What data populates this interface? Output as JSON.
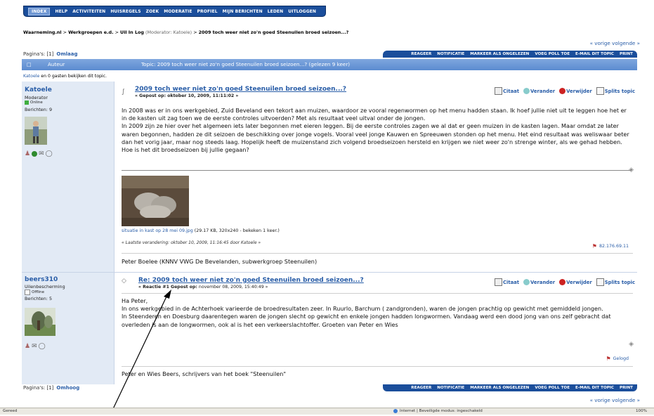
{
  "topnav": {
    "items": [
      "INDEX",
      "HELP",
      "ACTIVITEITEN",
      "HUISREGELS",
      "ZOEK",
      "MODERATIE",
      "PROFIEL",
      "MIJN BERICHTEN",
      "LEDEN",
      "UITLOGGEN"
    ]
  },
  "breadcrumb": {
    "site": "Waarneming.nl",
    "sep": ">",
    "group": "Werkgroepen e.d.",
    "board": "Uil In Log",
    "moderator": "(Moderator: Katoele)",
    "topic": "2009 toch weer niet zo'n goed Steenuilen broed seizoen...?"
  },
  "prevnext": "« vorige volgende »",
  "pagination_top": {
    "label": "Pagina's: [1]",
    "link": "Omlaag"
  },
  "pagination_bottom": {
    "label": "Pagina's: [1]",
    "link": "Omhoog"
  },
  "topic_buttons": [
    "REAGEER",
    "NOTIFICATIE",
    "MARKEER ALS ONGELEZEN",
    "VOEG POLL TOE",
    "E-MAIL DIT TOPIC",
    "PRINT"
  ],
  "header_bar": {
    "author": "Auteur",
    "topic": "Topic: 2009 toch weer niet zo'n goed Steenuilen broed seizoen...? (gelezen 9 keer)"
  },
  "viewers": {
    "user": "Katoele",
    "rest": "en 0 gasten bekijken dit topic."
  },
  "post1": {
    "author": "Katoele",
    "role": "Moderator",
    "status": "Online",
    "posts": "Berichten: 9",
    "subject": "2009 toch weer niet zo'n goed Steenuilen broed seizoen...?",
    "posted": "« Gepost op: oktober 10, 2009, 11:11:02 »",
    "actions": [
      "Citaat",
      "Verander",
      "Verwijder",
      "Splits topic"
    ],
    "body": [
      "In 2008 was er in ons werkgebied, Zuid Beveland een tekort aan muizen, waardoor ze vooral regenwormen op het menu hadden staan. Ik hoef jullie niet uit te leggen hoe het er in de kasten uit zag toen we de eerste controles uitvoerden? Met als resultaat veel uitval onder de jongen.",
      "In 2009 zijn ze hier over het algemeen iets later begonnen met eieren leggen. Bij de eerste controles zagen we al dat er geen muizen in de kasten lagen. Maar omdat ze later waren begonnen, hadden ze dit seizoen de beschikking over jonge vogels. Vooral veel jonge Kauwen en Spreeuwen stonden op het menu. Het eind resultaat was weliswaar beter dan het vorig jaar, maar nog steeds laag. Hopelijk heeft de muizenstand zich volgend broedseizoen hersteld en krijgen we niet weer zo'n strenge winter, als we gehad hebben.",
      "Hoe is het dit broedseizoen bij jullie gegaan?"
    ],
    "attachment_name": "situatie in kast op 28 mei 09.jpg",
    "attachment_info": "(29.17 KB, 320x240 - bekeken 1 keer.)",
    "last_edit": "« Laatste verandering: oktober 10, 2009, 11:16:45 door Katoele »",
    "ip": "82.176.69.11",
    "signature": "Peter Boelee (KNNV VWG De Bevelanden, subwerkgroep Steenuilen)"
  },
  "post2": {
    "author": "beers310",
    "role": "Uilenbescherming",
    "status": "Offline",
    "posts": "Berichten: 5",
    "subject": "Re: 2009 toch weer niet zo'n goed Steenuilen broed seizoen...?",
    "posted_prefix": "« Reactie #1 Gepost op:",
    "posted_date": "november 08, 2009, 15:40:49 »",
    "actions": [
      "Citaat",
      "Verander",
      "Verwijder",
      "Splits topic"
    ],
    "body": [
      "Ha Peter,",
      "In ons werkgebied in de Achterhoek varieerde de broedresultaten zeer. In Ruurlo, Barchum ( zandgronden), waren de jongen prachtig op gewicht met gemiddeld jongen.",
      "In Steenderen en Doesburg daarentegen waren de jongen slecht op gewicht en enkele jongen hadden longwormen. Vandaag werd een dood jong van ons zelf gebracht dat overleden is aan de longwormen, ook al is het een verkeerslachtoffer. Groeten van Peter en Wies"
    ],
    "logged": "Gelogd",
    "signature": "Peter en Wies Beers, schrijvers van het boek \"Steenuilen\""
  },
  "statusbar": {
    "left": "Gereed",
    "zone": "Internet | Beveiligde modus: ingeschakeld",
    "zoom": "100%"
  },
  "colors": {
    "nav": "#1b4e9b",
    "link": "#2a5ea8",
    "leftcol": "#e2eaf5",
    "header": "#6f97d3"
  }
}
